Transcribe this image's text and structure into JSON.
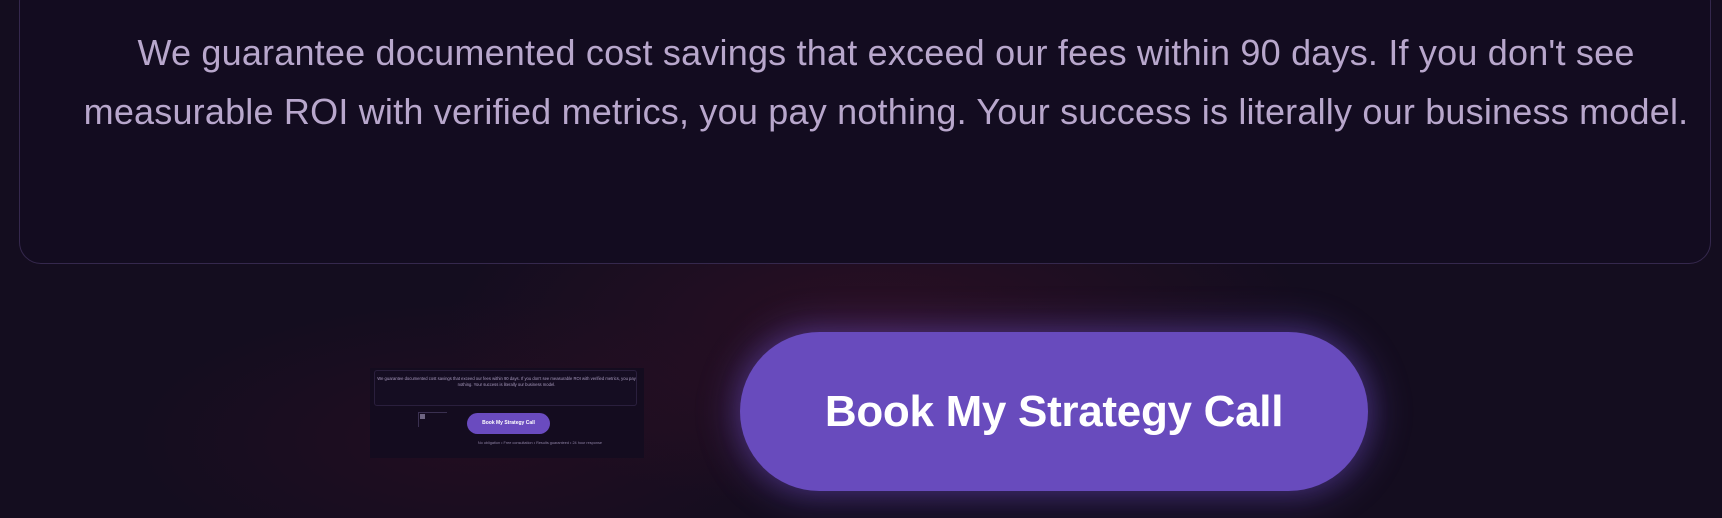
{
  "guarantee": {
    "text": "We guarantee documented cost savings that exceed our fees within 90 days. If you don't see measurable ROI with verified metrics, you pay nothing. Your success is literally our business model."
  },
  "thumbnail": {
    "text": "We guarantee documented cost savings that exceed our fees within 90 days. If you don't see measurable ROI with verified metrics, you pay nothing. Your success is literally our business model.",
    "button_label": "Book My Strategy Call",
    "meta_text": "No obligation • Free consultation • Results guaranteed • 24 hour response"
  },
  "cta": {
    "button_label": "Book My Strategy Call"
  },
  "colors": {
    "background": "#140d1f",
    "card_border": "#35284d",
    "text": "#b8a7cc",
    "button": "#684bbd"
  }
}
